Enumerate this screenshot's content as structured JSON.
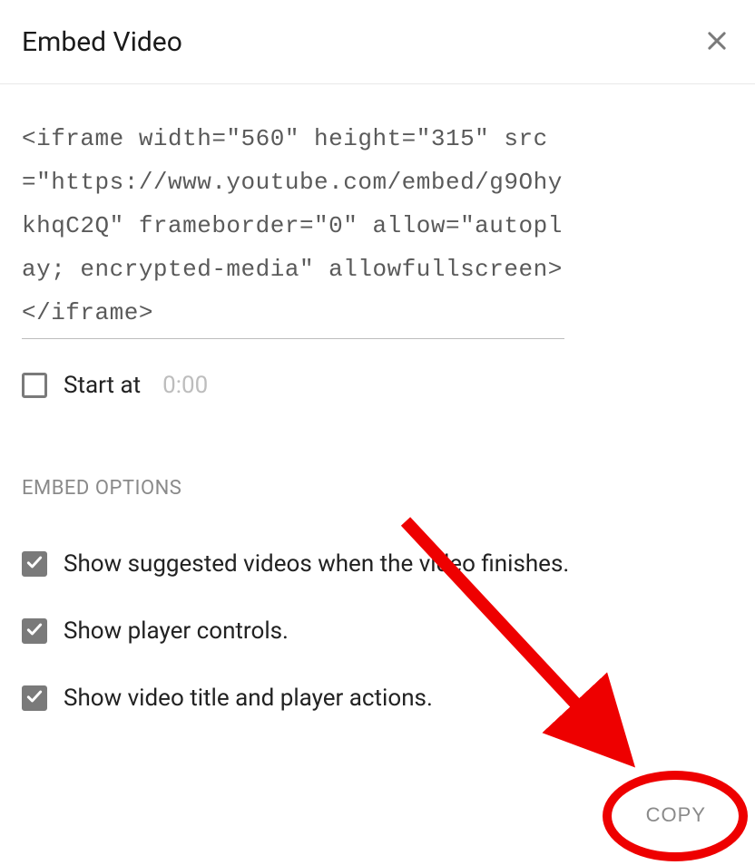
{
  "dialog": {
    "title": "Embed Video",
    "code": "<iframe width=\"560\" height=\"315\" src=\"https://www.youtube.com/embed/g9OhykhqC2Q\" frameborder=\"0\" allow=\"autoplay; encrypted-media\" allowfullscreen></iframe>",
    "start": {
      "label": "Start at",
      "time": "0:00",
      "checked": false
    },
    "section_title": "EMBED OPTIONS",
    "options": [
      {
        "label": "Show suggested videos when the video finishes.",
        "checked": true
      },
      {
        "label": "Show player controls.",
        "checked": true
      },
      {
        "label": "Show video title and player actions.",
        "checked": true
      }
    ],
    "copy_label": "COPY"
  },
  "annotation": {
    "arrow_color": "#ee0000",
    "ellipse_color": "#ee0000"
  }
}
